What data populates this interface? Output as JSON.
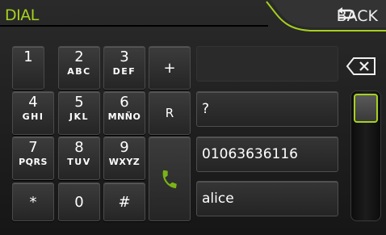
{
  "header": {
    "title": "DIAL",
    "back_label": "BACK"
  },
  "keypad": [
    {
      "digit": "1",
      "letters": ""
    },
    {
      "digit": "2",
      "letters": "ABC"
    },
    {
      "digit": "3",
      "letters": "DEF"
    },
    {
      "digit": "4",
      "letters": "GHI"
    },
    {
      "digit": "5",
      "letters": "JKL"
    },
    {
      "digit": "6",
      "letters": "MNÑO"
    },
    {
      "digit": "7",
      "letters": "PQRS"
    },
    {
      "digit": "8",
      "letters": "TUV"
    },
    {
      "digit": "9",
      "letters": "WXYZ"
    },
    {
      "digit": "*",
      "letters": ""
    },
    {
      "digit": "0",
      "letters": ""
    },
    {
      "digit": "#",
      "letters": ""
    }
  ],
  "side_keys": {
    "plus": "+",
    "r": "R"
  },
  "number_display": "",
  "suggestions": [
    "?",
    "01063636116",
    "alice"
  ],
  "colors": {
    "accent": "#a6d11f",
    "call_icon": "#7ab317"
  },
  "icons": {
    "back": "back-arrow-icon",
    "call": "phone-icon",
    "backspace": "backspace-icon"
  }
}
